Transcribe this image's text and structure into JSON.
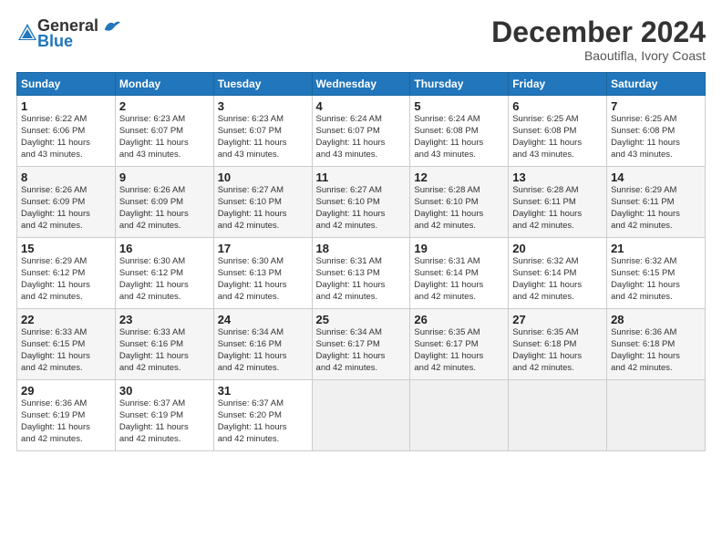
{
  "logo": {
    "line1": "General",
    "line2": "Blue"
  },
  "title": "December 2024",
  "subtitle": "Baoutifla, Ivory Coast",
  "header_days": [
    "Sunday",
    "Monday",
    "Tuesday",
    "Wednesday",
    "Thursday",
    "Friday",
    "Saturday"
  ],
  "weeks": [
    [
      {
        "day": "1",
        "info": "Sunrise: 6:22 AM\nSunset: 6:06 PM\nDaylight: 11 hours\nand 43 minutes."
      },
      {
        "day": "2",
        "info": "Sunrise: 6:23 AM\nSunset: 6:07 PM\nDaylight: 11 hours\nand 43 minutes."
      },
      {
        "day": "3",
        "info": "Sunrise: 6:23 AM\nSunset: 6:07 PM\nDaylight: 11 hours\nand 43 minutes."
      },
      {
        "day": "4",
        "info": "Sunrise: 6:24 AM\nSunset: 6:07 PM\nDaylight: 11 hours\nand 43 minutes."
      },
      {
        "day": "5",
        "info": "Sunrise: 6:24 AM\nSunset: 6:08 PM\nDaylight: 11 hours\nand 43 minutes."
      },
      {
        "day": "6",
        "info": "Sunrise: 6:25 AM\nSunset: 6:08 PM\nDaylight: 11 hours\nand 43 minutes."
      },
      {
        "day": "7",
        "info": "Sunrise: 6:25 AM\nSunset: 6:08 PM\nDaylight: 11 hours\nand 43 minutes."
      }
    ],
    [
      {
        "day": "8",
        "info": "Sunrise: 6:26 AM\nSunset: 6:09 PM\nDaylight: 11 hours\nand 42 minutes."
      },
      {
        "day": "9",
        "info": "Sunrise: 6:26 AM\nSunset: 6:09 PM\nDaylight: 11 hours\nand 42 minutes."
      },
      {
        "day": "10",
        "info": "Sunrise: 6:27 AM\nSunset: 6:10 PM\nDaylight: 11 hours\nand 42 minutes."
      },
      {
        "day": "11",
        "info": "Sunrise: 6:27 AM\nSunset: 6:10 PM\nDaylight: 11 hours\nand 42 minutes."
      },
      {
        "day": "12",
        "info": "Sunrise: 6:28 AM\nSunset: 6:10 PM\nDaylight: 11 hours\nand 42 minutes."
      },
      {
        "day": "13",
        "info": "Sunrise: 6:28 AM\nSunset: 6:11 PM\nDaylight: 11 hours\nand 42 minutes."
      },
      {
        "day": "14",
        "info": "Sunrise: 6:29 AM\nSunset: 6:11 PM\nDaylight: 11 hours\nand 42 minutes."
      }
    ],
    [
      {
        "day": "15",
        "info": "Sunrise: 6:29 AM\nSunset: 6:12 PM\nDaylight: 11 hours\nand 42 minutes."
      },
      {
        "day": "16",
        "info": "Sunrise: 6:30 AM\nSunset: 6:12 PM\nDaylight: 11 hours\nand 42 minutes."
      },
      {
        "day": "17",
        "info": "Sunrise: 6:30 AM\nSunset: 6:13 PM\nDaylight: 11 hours\nand 42 minutes."
      },
      {
        "day": "18",
        "info": "Sunrise: 6:31 AM\nSunset: 6:13 PM\nDaylight: 11 hours\nand 42 minutes."
      },
      {
        "day": "19",
        "info": "Sunrise: 6:31 AM\nSunset: 6:14 PM\nDaylight: 11 hours\nand 42 minutes."
      },
      {
        "day": "20",
        "info": "Sunrise: 6:32 AM\nSunset: 6:14 PM\nDaylight: 11 hours\nand 42 minutes."
      },
      {
        "day": "21",
        "info": "Sunrise: 6:32 AM\nSunset: 6:15 PM\nDaylight: 11 hours\nand 42 minutes."
      }
    ],
    [
      {
        "day": "22",
        "info": "Sunrise: 6:33 AM\nSunset: 6:15 PM\nDaylight: 11 hours\nand 42 minutes."
      },
      {
        "day": "23",
        "info": "Sunrise: 6:33 AM\nSunset: 6:16 PM\nDaylight: 11 hours\nand 42 minutes."
      },
      {
        "day": "24",
        "info": "Sunrise: 6:34 AM\nSunset: 6:16 PM\nDaylight: 11 hours\nand 42 minutes."
      },
      {
        "day": "25",
        "info": "Sunrise: 6:34 AM\nSunset: 6:17 PM\nDaylight: 11 hours\nand 42 minutes."
      },
      {
        "day": "26",
        "info": "Sunrise: 6:35 AM\nSunset: 6:17 PM\nDaylight: 11 hours\nand 42 minutes."
      },
      {
        "day": "27",
        "info": "Sunrise: 6:35 AM\nSunset: 6:18 PM\nDaylight: 11 hours\nand 42 minutes."
      },
      {
        "day": "28",
        "info": "Sunrise: 6:36 AM\nSunset: 6:18 PM\nDaylight: 11 hours\nand 42 minutes."
      }
    ],
    [
      {
        "day": "29",
        "info": "Sunrise: 6:36 AM\nSunset: 6:19 PM\nDaylight: 11 hours\nand 42 minutes."
      },
      {
        "day": "30",
        "info": "Sunrise: 6:37 AM\nSunset: 6:19 PM\nDaylight: 11 hours\nand 42 minutes."
      },
      {
        "day": "31",
        "info": "Sunrise: 6:37 AM\nSunset: 6:20 PM\nDaylight: 11 hours\nand 42 minutes."
      },
      {
        "day": "",
        "info": ""
      },
      {
        "day": "",
        "info": ""
      },
      {
        "day": "",
        "info": ""
      },
      {
        "day": "",
        "info": ""
      }
    ]
  ]
}
